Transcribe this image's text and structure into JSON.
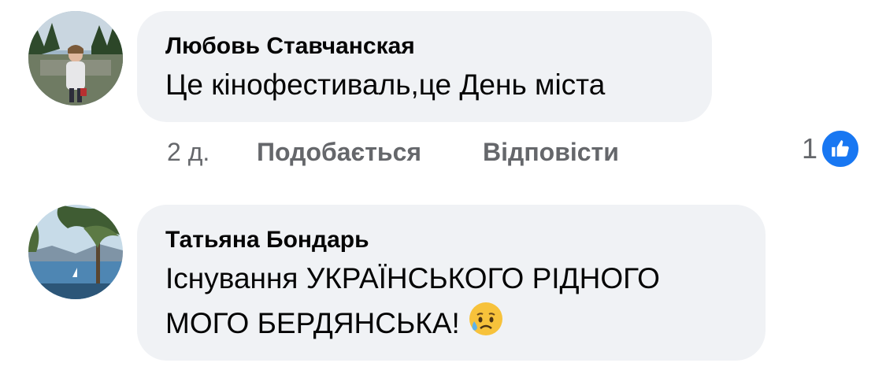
{
  "comments": [
    {
      "author": "Любовь Ставчанская",
      "text_lines": [
        "Це кінофестиваль,це День міста"
      ],
      "time": "2 д.",
      "like_label": "Подобається",
      "reply_label": "Відповісти",
      "reaction_count": "1",
      "reaction_icon": "thumbs-up-icon"
    },
    {
      "author": "Татьяна Бондарь",
      "text_lines": [
        "Існування УКРАЇНСЬКОГО РІДНОГО",
        "МОГО БЕРДЯНСЬКА!"
      ],
      "emoji": "sad-sweat-face-emoji"
    }
  ],
  "colors": {
    "bubble": "#f0f2f5",
    "secondary_text": "#65676b",
    "like_blue": "#1877f2"
  }
}
